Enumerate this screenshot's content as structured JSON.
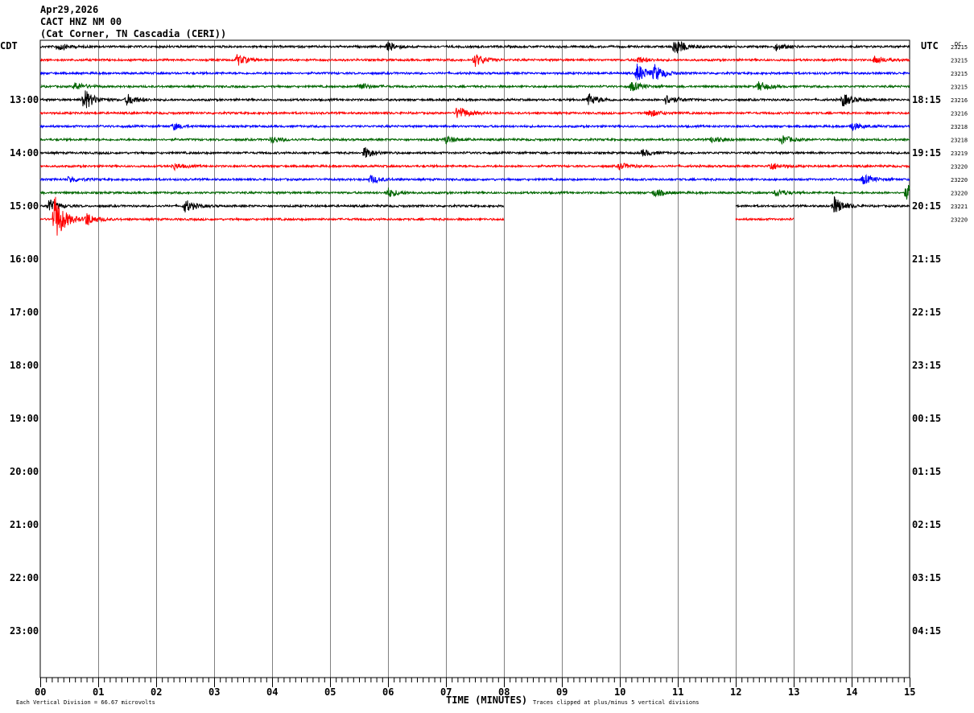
{
  "header": {
    "date": "Apr29,2026",
    "station": "CACT HNZ NM 00",
    "location": "(Cat Corner, TN Cascadia (CERI))"
  },
  "left_tz": "CDT",
  "right_tz": "UTC",
  "dc_label": "DC",
  "footer": {
    "vertical_division": "Each Vertical Division =   66.67 microvolts",
    "x_axis_title": "TIME (MINUTES)",
    "clip_note": "Traces clipped at plus/minus 5 vertical divisions"
  },
  "colors": {
    "trace_cycle": [
      "#000000",
      "#ff0000",
      "#0000ff",
      "#006600"
    ],
    "grid": "#808080",
    "frame": "#000000"
  },
  "chart_data": {
    "type": "line",
    "title": "",
    "xlabel": "TIME (MINUTES)",
    "ylabel": "",
    "xlim": [
      0,
      15
    ],
    "x_ticks": [
      "00",
      "01",
      "02",
      "03",
      "04",
      "05",
      "06",
      "07",
      "08",
      "09",
      "10",
      "11",
      "12",
      "13",
      "14",
      "15"
    ],
    "y_left_labels": [
      "13:00",
      "14:00",
      "15:00",
      "16:00",
      "17:00",
      "18:00",
      "19:00",
      "20:00",
      "21:00",
      "22:00",
      "23:00"
    ],
    "y_right_labels": [
      "18:15",
      "19:15",
      "20:15",
      "21:15",
      "22:15",
      "23:15",
      "00:15",
      "01:15",
      "02:15",
      "03:15",
      "04:15"
    ],
    "label_row_interval": 4,
    "total_rows": 48,
    "traces": [
      {
        "row": 0,
        "color": "#000000",
        "dc": "23215",
        "end_min": 15,
        "events": [
          {
            "t": 0.3,
            "a": 5
          },
          {
            "t": 6.0,
            "a": 5
          },
          {
            "t": 10.95,
            "a": 11
          },
          {
            "t": 12.7,
            "a": 4
          }
        ]
      },
      {
        "row": 1,
        "color": "#ff0000",
        "dc": "23215",
        "end_min": 15,
        "events": [
          {
            "t": 3.4,
            "a": 7
          },
          {
            "t": 7.5,
            "a": 8
          },
          {
            "t": 10.3,
            "a": 4
          },
          {
            "t": 14.4,
            "a": 5
          }
        ]
      },
      {
        "row": 2,
        "color": "#0000ff",
        "dc": "23215",
        "end_min": 15,
        "events": [
          {
            "t": 10.3,
            "a": 12
          },
          {
            "t": 10.6,
            "a": 9
          }
        ]
      },
      {
        "row": 3,
        "color": "#006600",
        "dc": "23215",
        "end_min": 15,
        "events": [
          {
            "t": 0.6,
            "a": 5
          },
          {
            "t": 5.5,
            "a": 5
          },
          {
            "t": 10.2,
            "a": 6
          },
          {
            "t": 12.4,
            "a": 6
          }
        ]
      },
      {
        "row": 4,
        "color": "#000000",
        "dc": "23216",
        "end_min": 15,
        "events": [
          {
            "t": 0.75,
            "a": 14
          },
          {
            "t": 1.5,
            "a": 7
          },
          {
            "t": 9.45,
            "a": 8
          },
          {
            "t": 10.8,
            "a": 6
          },
          {
            "t": 13.85,
            "a": 8
          }
        ]
      },
      {
        "row": 5,
        "color": "#ff0000",
        "dc": "23216",
        "end_min": 15,
        "events": [
          {
            "t": 7.2,
            "a": 9
          },
          {
            "t": 10.5,
            "a": 5
          }
        ]
      },
      {
        "row": 6,
        "color": "#0000ff",
        "dc": "23218",
        "end_min": 15,
        "events": [
          {
            "t": 2.3,
            "a": 4
          },
          {
            "t": 14.0,
            "a": 5
          }
        ]
      },
      {
        "row": 7,
        "color": "#006600",
        "dc": "23218",
        "end_min": 15,
        "events": [
          {
            "t": 4.0,
            "a": 4
          },
          {
            "t": 7.0,
            "a": 5
          },
          {
            "t": 11.6,
            "a": 4
          },
          {
            "t": 12.8,
            "a": 5
          }
        ]
      },
      {
        "row": 8,
        "color": "#000000",
        "dc": "23219",
        "end_min": 15,
        "events": [
          {
            "t": 5.6,
            "a": 7
          },
          {
            "t": 10.4,
            "a": 4
          }
        ]
      },
      {
        "row": 9,
        "color": "#ff0000",
        "dc": "23220",
        "end_min": 15,
        "events": [
          {
            "t": 2.3,
            "a": 4
          },
          {
            "t": 10.0,
            "a": 4
          },
          {
            "t": 12.6,
            "a": 5
          }
        ]
      },
      {
        "row": 10,
        "color": "#0000ff",
        "dc": "23220",
        "end_min": 15,
        "events": [
          {
            "t": 0.5,
            "a": 4
          },
          {
            "t": 5.7,
            "a": 5
          },
          {
            "t": 14.2,
            "a": 6
          }
        ]
      },
      {
        "row": 11,
        "color": "#006600",
        "dc": "23220",
        "end_min": 15,
        "events": [
          {
            "t": 6.0,
            "a": 6
          },
          {
            "t": 10.6,
            "a": 5
          },
          {
            "t": 12.7,
            "a": 5
          },
          {
            "t": 14.95,
            "a": 10
          }
        ]
      },
      {
        "row": 12,
        "color": "#000000",
        "dc": "23221",
        "end_min": 15,
        "gap": [
          8.0,
          12.0
        ],
        "events": [
          {
            "t": 0.15,
            "a": 8
          },
          {
            "t": 2.5,
            "a": 8
          },
          {
            "t": 13.7,
            "a": 11
          }
        ]
      },
      {
        "row": 13,
        "color": "#ff0000",
        "dc": "23220",
        "end_min": 13.0,
        "gap": [
          8.0,
          12.0
        ],
        "events": [
          {
            "t": 0.25,
            "a": 30
          },
          {
            "t": 0.8,
            "a": 8
          }
        ]
      }
    ]
  }
}
